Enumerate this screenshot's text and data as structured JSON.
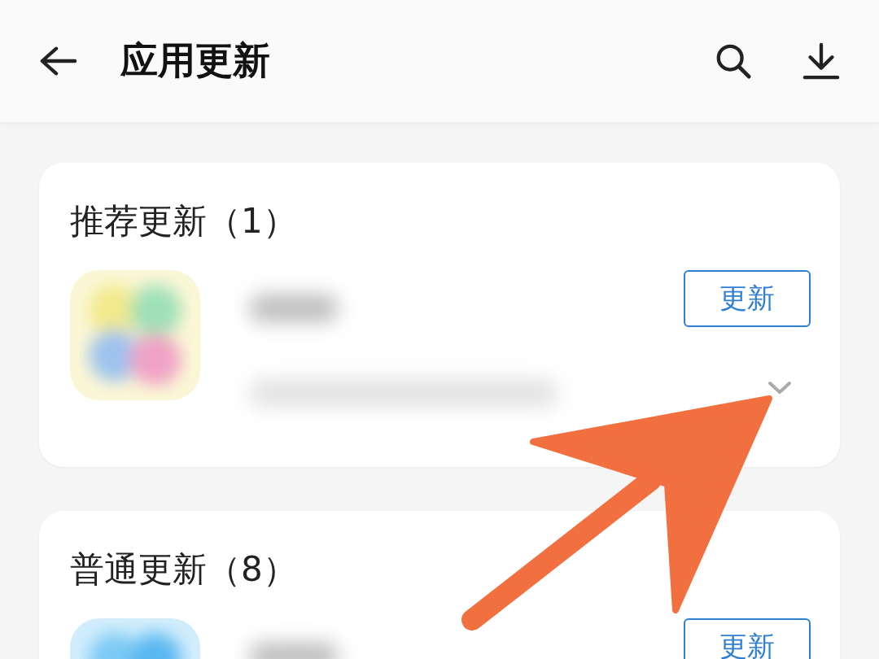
{
  "header": {
    "title": "应用更新"
  },
  "sections": [
    {
      "title": "推荐更新（1）",
      "apps": [
        {
          "button": "更新",
          "chevron": true
        }
      ]
    },
    {
      "title": "普通更新（8）",
      "apps": [
        {
          "button": "更新",
          "chevron": false
        }
      ]
    }
  ],
  "annotation": {
    "kind": "arrow"
  }
}
